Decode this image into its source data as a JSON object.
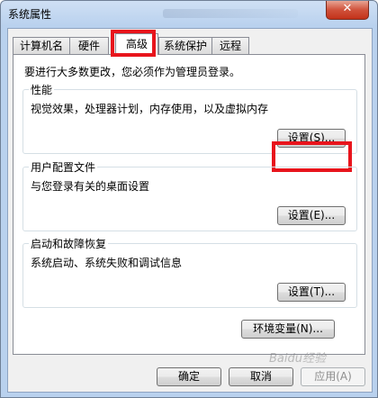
{
  "window": {
    "title": "系统属性"
  },
  "tabs": [
    {
      "label": "计算机名",
      "active": false
    },
    {
      "label": "硬件",
      "active": false
    },
    {
      "label": "高级",
      "active": true
    },
    {
      "label": "系统保护",
      "active": false
    },
    {
      "label": "远程",
      "active": false
    }
  ],
  "intro": "要进行大多数更改，您必须作为管理员登录。",
  "performance": {
    "title": "性能",
    "desc": "视觉效果，处理器计划，内存使用，以及虚拟内存",
    "button": "设置(S)..."
  },
  "user_profiles": {
    "title": "用户配置文件",
    "desc": "与您登录有关的桌面设置",
    "button": "设置(E)..."
  },
  "startup": {
    "title": "启动和故障恢复",
    "desc": "系统启动、系统失败和调试信息",
    "button": "设置(T)..."
  },
  "env_button": "环境变量(N)...",
  "footer": {
    "ok": "确定",
    "cancel": "取消",
    "apply": "应用(A)"
  },
  "watermark": "Baidu经验",
  "colors": {
    "highlight": "#e8141c",
    "close_button": "#c3321a"
  }
}
